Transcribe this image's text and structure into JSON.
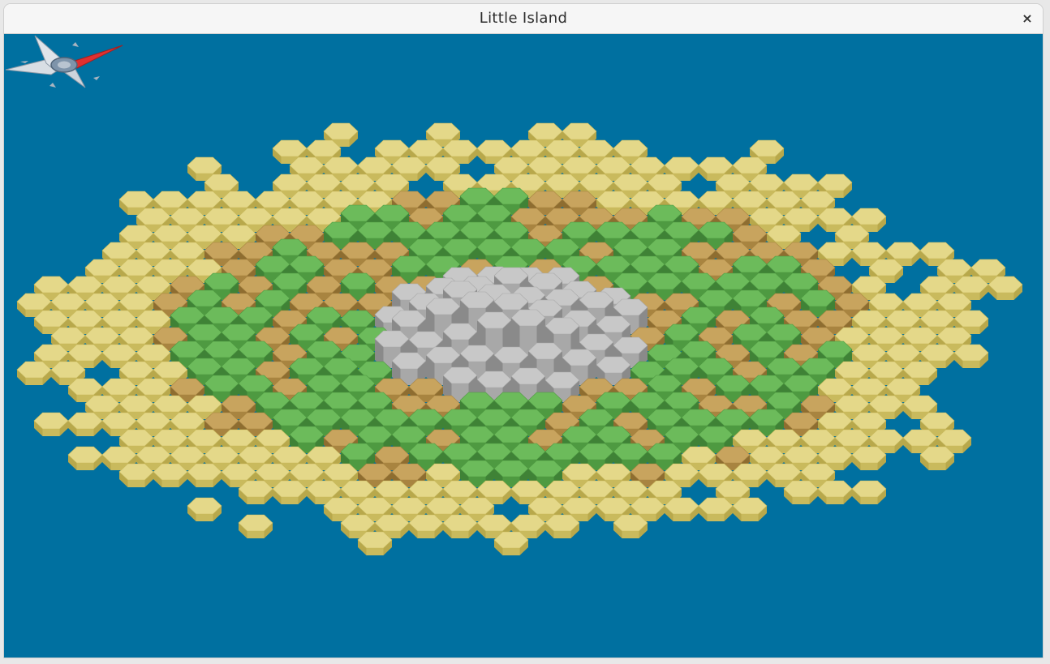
{
  "window": {
    "title": "Little Island",
    "close_glyph": "×"
  },
  "scene": {
    "water_color": "#0070a0",
    "terrain_palette": {
      "sand": {
        "top": "#e4d889",
        "side": "#c9ba5d",
        "dark": "#b8a84b"
      },
      "dirt": {
        "top": "#c8a45e",
        "side": "#a88440",
        "dark": "#8e6d30"
      },
      "grass": {
        "top": "#6cbb5b",
        "side": "#4e9a41",
        "dark": "#3f8236"
      },
      "rock": {
        "top": "#c8c8c8",
        "side": "#a8a8a8",
        "dark": "#8a8a8a"
      }
    },
    "compass_colors": {
      "needle_red": "#e03030",
      "body": "#c0c8d0",
      "ring": "#607890"
    }
  }
}
